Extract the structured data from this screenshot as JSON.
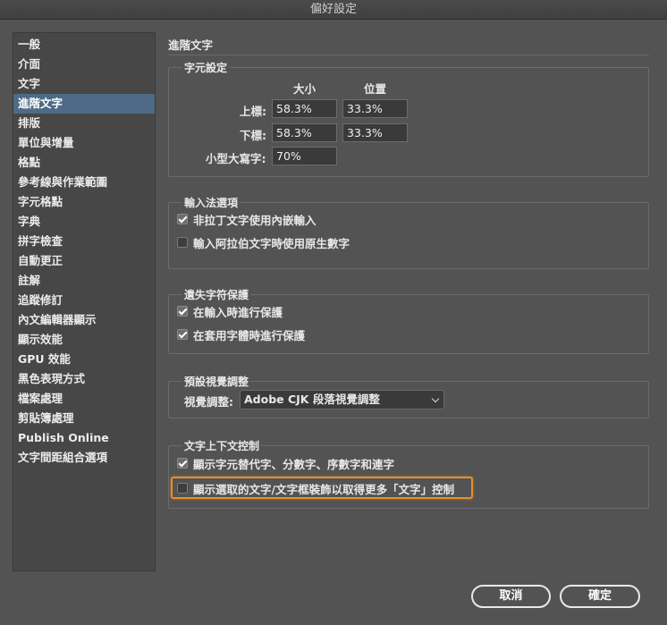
{
  "window": {
    "title": "偏好設定"
  },
  "sidebar": {
    "items": [
      {
        "label": "一般"
      },
      {
        "label": "介面"
      },
      {
        "label": "文字"
      },
      {
        "label": "進階文字",
        "selected": true
      },
      {
        "label": "排版"
      },
      {
        "label": "單位與增量"
      },
      {
        "label": "格點"
      },
      {
        "label": "參考線與作業範圍"
      },
      {
        "label": "字元格點"
      },
      {
        "label": "字典"
      },
      {
        "label": "拼字檢查"
      },
      {
        "label": "自動更正"
      },
      {
        "label": "註解"
      },
      {
        "label": "追蹤修訂"
      },
      {
        "label": "內文編輯器顯示"
      },
      {
        "label": "顯示效能"
      },
      {
        "label": "GPU 效能"
      },
      {
        "label": "黑色表現方式"
      },
      {
        "label": "檔案處理"
      },
      {
        "label": "剪貼簿處理"
      },
      {
        "label": "Publish Online"
      },
      {
        "label": "文字間距組合選項"
      }
    ]
  },
  "main": {
    "title": "進階文字",
    "char_settings": {
      "title": "字元設定",
      "col_size": "大小",
      "col_position": "位置",
      "superscript_label": "上標:",
      "superscript_size": "58.3%",
      "superscript_position": "33.3%",
      "subscript_label": "下標:",
      "subscript_size": "58.3%",
      "subscript_position": "33.3%",
      "smallcaps_label": "小型大寫字:",
      "smallcaps_size": "70%"
    },
    "input_method": {
      "title": "輸入法選項",
      "option1": {
        "label": "非拉丁文字使用內嵌輸入",
        "checked": true
      },
      "option2": {
        "label": "輸入阿拉伯文字時使用原生數字",
        "checked": false
      }
    },
    "missing_glyph": {
      "title": "遺失字符保護",
      "option1": {
        "label": "在輸入時進行保護",
        "checked": true
      },
      "option2": {
        "label": "在套用字體時進行保護",
        "checked": true
      }
    },
    "optical": {
      "title": "預設視覺調整",
      "label": "視覺調整:",
      "value": "Adobe CJK 段落視覺調整"
    },
    "context_controls": {
      "title": "文字上下文控制",
      "option1": {
        "label": "顯示字元替代字、分數字、序數字和連字",
        "checked": true
      },
      "option2": {
        "label": "顯示選取的文字/文字框裝飾以取得更多「文字」控制",
        "checked": false
      }
    }
  },
  "buttons": {
    "cancel": "取消",
    "ok": "確定"
  },
  "colors": {
    "highlight": "#e8912b",
    "selection": "#4d6a86"
  }
}
